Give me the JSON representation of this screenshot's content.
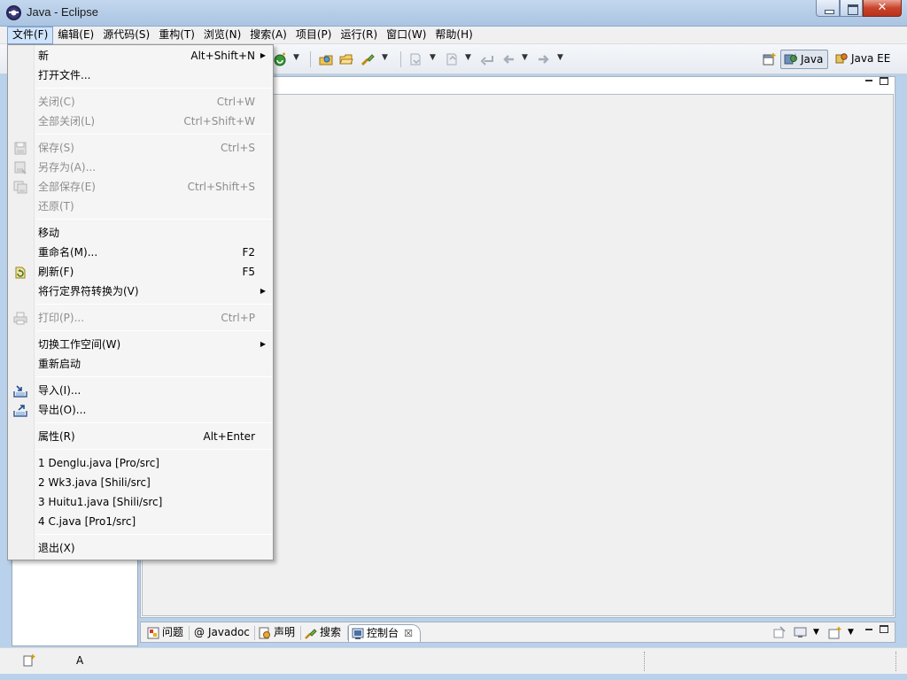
{
  "window": {
    "title": "Java  -  Eclipse",
    "close_glyph": "✕"
  },
  "menubar": {
    "items": [
      "文件(F)",
      "编辑(E)",
      "源代码(S)",
      "重构(T)",
      "浏览(N)",
      "搜索(A)",
      "项目(P)",
      "运行(R)",
      "窗口(W)",
      "帮助(H)"
    ],
    "active_index": 0
  },
  "perspectives": {
    "java": "Java",
    "java_ee": "Java EE"
  },
  "file_menu": {
    "new": {
      "label": "新",
      "accel": "Alt+Shift+N"
    },
    "open_file": {
      "label": "打开文件..."
    },
    "close": {
      "label": "关闭(C)",
      "accel": "Ctrl+W"
    },
    "close_all": {
      "label": "全部关闭(L)",
      "accel": "Ctrl+Shift+W"
    },
    "save": {
      "label": "保存(S)",
      "accel": "Ctrl+S"
    },
    "save_as": {
      "label": "另存为(A)..."
    },
    "save_all": {
      "label": "全部保存(E)",
      "accel": "Ctrl+Shift+S"
    },
    "revert": {
      "label": "还原(T)"
    },
    "move": {
      "label": "移动"
    },
    "rename": {
      "label": "重命名(M)...",
      "accel": "F2"
    },
    "refresh": {
      "label": "刷新(F)",
      "accel": "F5"
    },
    "convert_line_delimiters": {
      "label": "将行定界符转换为(V)"
    },
    "print": {
      "label": "打印(P)...",
      "accel": "Ctrl+P"
    },
    "switch_workspace": {
      "label": "切换工作空间(W)"
    },
    "restart": {
      "label": "重新启动"
    },
    "import": {
      "label": "导入(I)..."
    },
    "export": {
      "label": "导出(O)..."
    },
    "properties": {
      "label": "属性(R)",
      "accel": "Alt+Enter"
    },
    "recent": [
      "1 Denglu.java  [Pro/src]",
      "2 Wk3.java  [Shili/src]",
      "3 Huitu1.java  [Shili/src]",
      "4 C.java  [Pro1/src]"
    ],
    "exit": {
      "label": "退出(X)"
    }
  },
  "bottom_tabs": {
    "problems": "问题",
    "javadoc": "Javadoc",
    "declaration": "声明",
    "search": "搜索",
    "console": "控制台",
    "close_glyph": "☒"
  },
  "status": {
    "text": "A"
  }
}
